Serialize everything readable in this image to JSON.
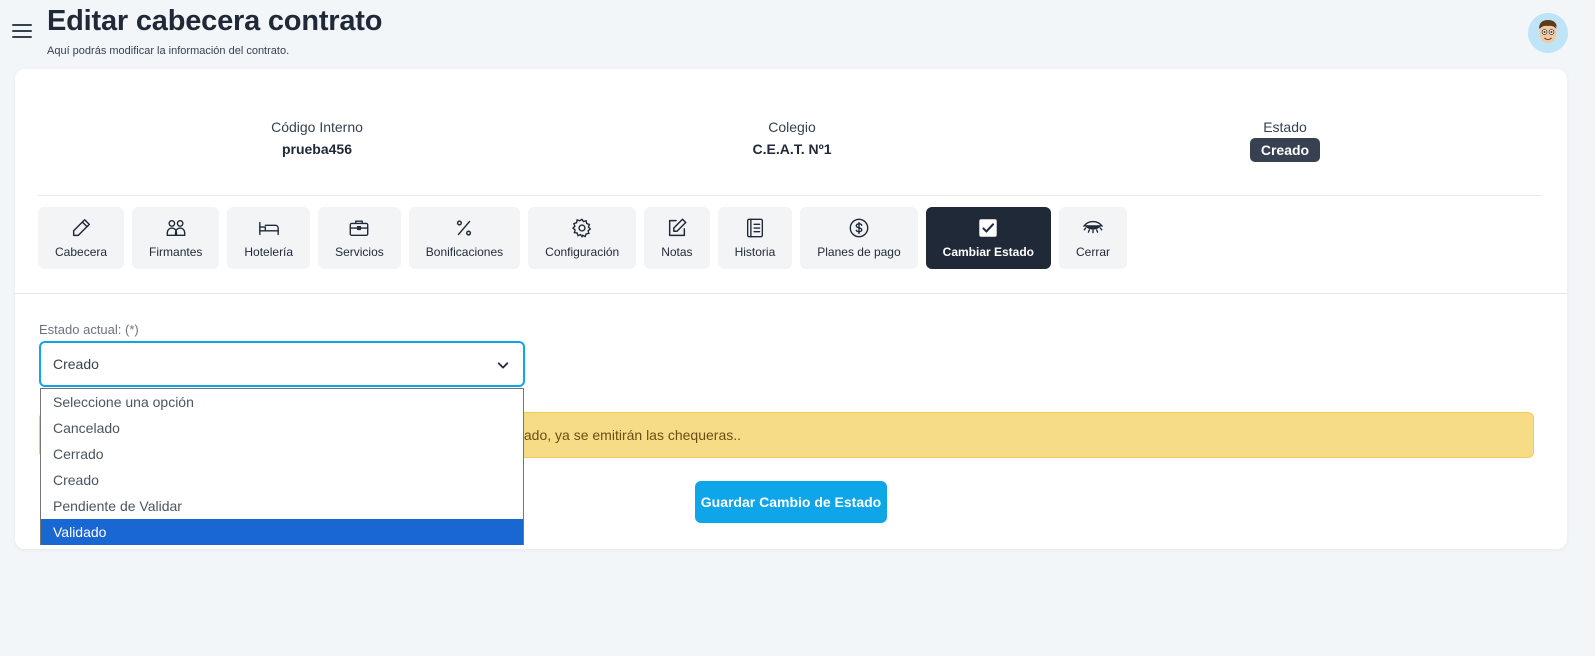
{
  "header": {
    "title": "Editar cabecera contrato",
    "subtitle": "Aquí podrás modificar la información del contrato."
  },
  "info": {
    "codigo_label": "Código Interno",
    "codigo_value": "prueba456",
    "colegio_label": "Colegio",
    "colegio_value": "C.E.A.T. Nº1",
    "estado_label": "Estado",
    "estado_value": "Creado"
  },
  "tabs": [
    {
      "label": "Cabecera",
      "icon": "pencil-icon"
    },
    {
      "label": "Firmantes",
      "icon": "users-icon"
    },
    {
      "label": "Hotelería",
      "icon": "bed-icon"
    },
    {
      "label": "Servicios",
      "icon": "briefcase-icon"
    },
    {
      "label": "Bonificaciones",
      "icon": "percent-icon"
    },
    {
      "label": "Configuración",
      "icon": "gear-icon"
    },
    {
      "label": "Notas",
      "icon": "edit-note-icon"
    },
    {
      "label": "Historia",
      "icon": "journal-icon"
    },
    {
      "label": "Planes de pago",
      "icon": "dollar-circle-icon"
    },
    {
      "label": "Cambiar Estado",
      "icon": "check-square-icon",
      "active": true
    },
    {
      "label": "Cerrar",
      "icon": "eye-closed-icon"
    }
  ],
  "form": {
    "label": "Estado actual: (*)",
    "selected": "Creado",
    "options": [
      "Seleccione una opción",
      "Cancelado",
      "Cerrado",
      "Creado",
      "Pendiente de Validar",
      "Validado"
    ],
    "highlighted_option": "Validado"
  },
  "alert": {
    "text": "idado, ya se emitirán las chequeras.."
  },
  "save_button": "Guardar Cambio de Estado",
  "colors": {
    "accent": "#0ea5e9",
    "active_tab": "#1f2937",
    "badge": "#374151",
    "alert_bg": "#f7dc87",
    "dropdown_highlight": "#1967d2"
  }
}
